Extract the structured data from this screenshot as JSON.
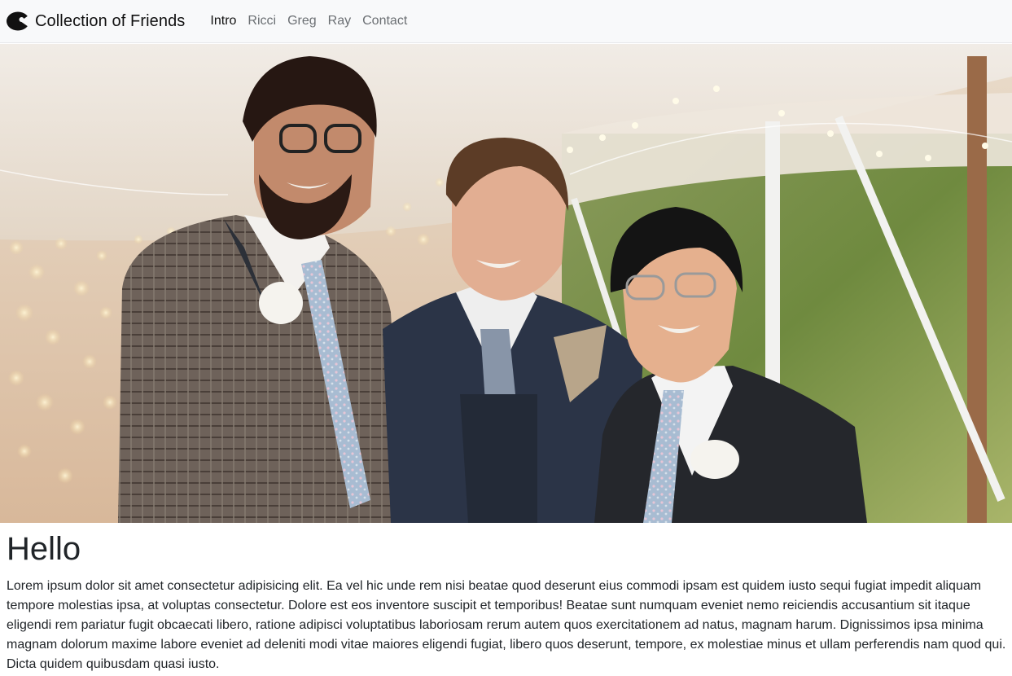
{
  "navbar": {
    "brand_icon": "pacman-logo-icon",
    "brand": "Collection of Friends",
    "links": [
      {
        "label": "Intro",
        "active": true
      },
      {
        "label": "Ricci",
        "active": false
      },
      {
        "label": "Greg",
        "active": false
      },
      {
        "label": "Ray",
        "active": false
      },
      {
        "label": "Contact",
        "active": false
      }
    ]
  },
  "hero": {
    "image": "group-photo-three-friends-in-suits"
  },
  "main": {
    "heading": "Hello",
    "paragraph": "Lorem ipsum dolor sit amet consectetur adipisicing elit. Ea vel hic unde rem nisi beatae quod deserunt eius commodi ipsam est quidem iusto sequi fugiat impedit aliquam tempore molestias ipsa, at voluptas consectetur. Dolore est eos inventore suscipit et temporibus! Beatae sunt numquam eveniet nemo reiciendis accusantium sit itaque eligendi rem pariatur fugit obcaecati libero, ratione adipisci voluptatibus laboriosam rerum autem quos exercitationem ad natus, magnam harum. Dignissimos ipsa minima magnam dolorum maxime labore eveniet ad deleniti modi vitae maiores eligendi fugiat, libero quos deserunt, tempore, ex molestiae minus et ullam perferendis nam quod qui. Dicta quidem quibusdam quasi iusto."
  },
  "colors": {
    "navbar_bg": "#f8f9fa",
    "link_muted": "#6b6f73",
    "link_active": "#111111",
    "text": "#212529"
  }
}
